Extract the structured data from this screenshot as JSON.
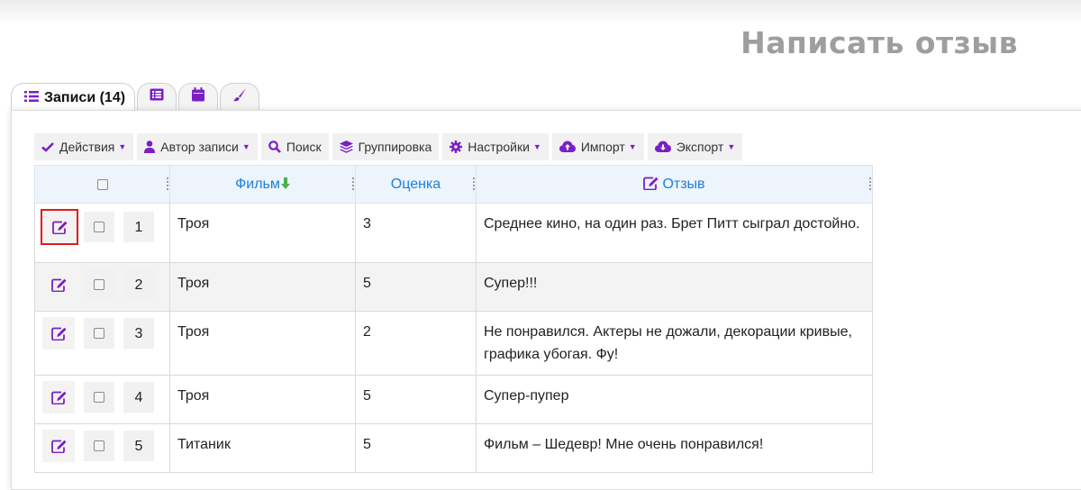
{
  "header": {
    "title": "Написать отзыв"
  },
  "tabs": [
    {
      "label": "Записи (14)",
      "icon": "list-icon"
    },
    {
      "icon": "table-list-icon"
    },
    {
      "icon": "calendar-icon"
    },
    {
      "icon": "brush-icon"
    }
  ],
  "toolbar": {
    "actions": "Действия",
    "author": "Автор записи",
    "search": "Поиск",
    "grouping": "Группировка",
    "settings": "Настройки",
    "import": "Импорт",
    "export": "Экспорт"
  },
  "table": {
    "columns": {
      "film": "Фильм",
      "rating": "Оценка",
      "review": "Отзыв"
    },
    "rows": [
      {
        "num": "1",
        "film": "Троя",
        "rating": "3",
        "review": "Среднее кино, на один раз. Брет Питт сыграл достойно."
      },
      {
        "num": "2",
        "film": "Троя",
        "rating": "5",
        "review": "Супер!!!"
      },
      {
        "num": "3",
        "film": "Троя",
        "rating": "2",
        "review": "Не понравился. Актеры не дожали, декорации кривые, графика убогая. Фу!"
      },
      {
        "num": "4",
        "film": "Троя",
        "rating": "5",
        "review": "Супер-пупер"
      },
      {
        "num": "5",
        "film": "Титаник",
        "rating": "5",
        "review": "Фильм – Шедевр! Мне очень понравился!"
      }
    ]
  },
  "colors": {
    "accent": "#7b1fc4",
    "link": "#1e7fd9",
    "sort_arrow": "#4caf50",
    "highlight": "#e01c1c"
  }
}
